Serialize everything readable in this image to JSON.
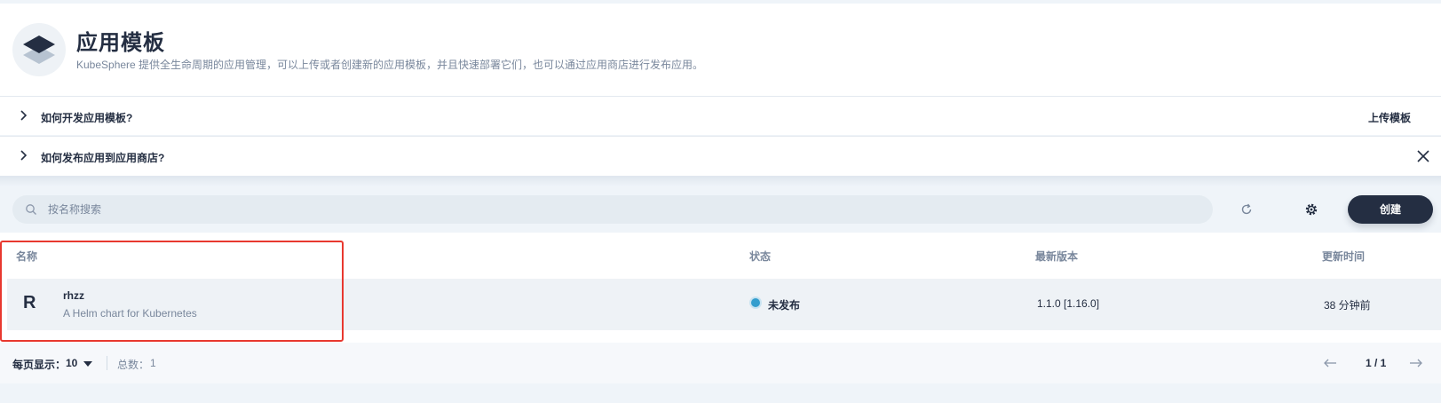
{
  "banner": {
    "title": "应用模板",
    "description": "KubeSphere 提供全生命周期的应用管理，可以上传或者创建新的应用模板，并且快速部署它们，也可以通过应用商店进行发布应用。",
    "logo_icon": "layers-icon"
  },
  "tips": [
    {
      "label": "如何开发应用模板?",
      "action": "上传模板"
    },
    {
      "label": "如何发布应用到应用商店?"
    }
  ],
  "toolbar": {
    "search_placeholder": "按名称搜索",
    "create_label": "创建"
  },
  "table": {
    "columns": [
      "名称",
      "状态",
      "最新版本",
      "更新时间"
    ],
    "rows": [
      {
        "avatar": "R",
        "name": "rhzz",
        "description": "A Helm chart for Kubernetes",
        "status": "未发布",
        "status_color": "#329dce",
        "version": "1.1.0 [1.16.0]",
        "updated": "38 分钟前"
      }
    ]
  },
  "footer": {
    "per_page_label": "每页显示：",
    "per_page_value": "10",
    "total_label": "总数：",
    "total_value": "1",
    "page": "1 / 1"
  },
  "colors": {
    "primary": "#242e42",
    "muted": "#79879c",
    "highlight": "#e8382f"
  }
}
